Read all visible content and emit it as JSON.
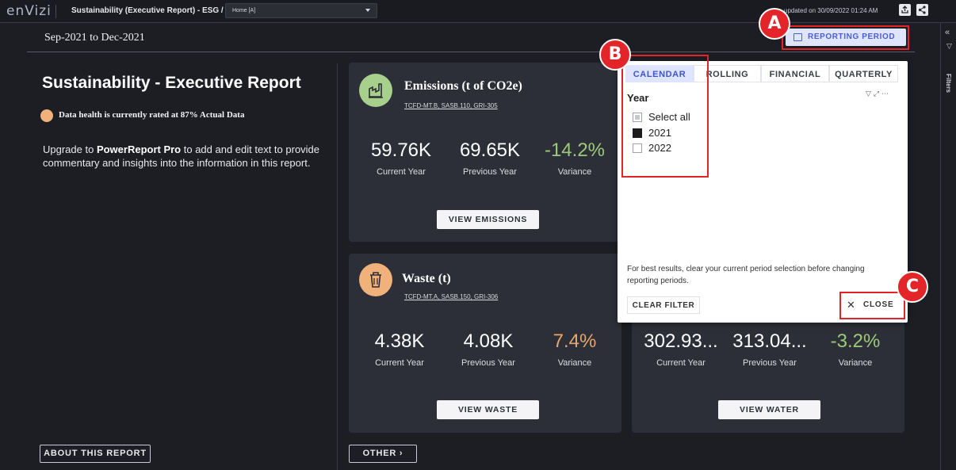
{
  "topbar": {
    "logo": "enVizi",
    "breadcrumb": "Sustainability (Executive Report) - ESG  /",
    "home_select": "Home [A]",
    "updated": "updated on 30/09/2022 01:24 AM",
    "icons": [
      "export-icon",
      "share-icon"
    ]
  },
  "filters_rail": {
    "label": "Filters"
  },
  "period": {
    "range": "Sep-2021 to Dec-2021",
    "button_label": "REPORTING PERIOD"
  },
  "left": {
    "title": "Sustainability - Executive Report",
    "health": "Data health is currently rated at 87% Actual Data",
    "health_color": "#f0b27a",
    "upgrade_pre": "Upgrade to ",
    "upgrade_bold": "PowerReport Pro",
    "upgrade_post": " to add and edit text to provide commentary and insights into the information in this report.",
    "about_button": "ABOUT THIS REPORT",
    "other_button": "OTHER  ›"
  },
  "cards": {
    "emissions": {
      "title": "Emissions (t of CO2e)",
      "sub": "TCFD-MT.B, SASB.110, GRI-305",
      "current": "59.76K",
      "previous": "69.65K",
      "variance": "-14.2%",
      "variance_color": "#9dc97a",
      "icon_color": "#a8d08d",
      "button": "VIEW EMISSIONS"
    },
    "waste": {
      "title": "Waste (t)",
      "sub": "TCFD-MT.A, SASB.150, GRI-306",
      "current": "4.38K",
      "previous": "4.08K",
      "variance": "7.4%",
      "variance_color": "#e8a76a",
      "icon_color": "#f0b27a",
      "button": "VIEW WASTE"
    },
    "water": {
      "current": "302.93...",
      "previous": "313.04...",
      "variance": "-3.2%",
      "variance_color": "#9dc97a",
      "button": "VIEW WATER"
    },
    "labels": {
      "current": "Current Year",
      "previous": "Previous Year",
      "variance": "Variance"
    }
  },
  "popup": {
    "tabs": [
      "CALENDAR",
      "ROLLING",
      "FINANCIAL",
      "QUARTERLY"
    ],
    "active_tab": "CALENDAR",
    "field": "Year",
    "options": [
      {
        "label": "Select all",
        "state": "partial"
      },
      {
        "label": "2021",
        "state": "checked"
      },
      {
        "label": "2022",
        "state": "unchecked"
      }
    ],
    "mini_icons": [
      "filter-icon",
      "expand-icon",
      "more-icon"
    ],
    "hint": "For best results, clear your current period selection before changing reporting periods.",
    "clear_button": "CLEAR FILTER",
    "close_button": "CLOSE"
  },
  "annotations": {
    "a": "A",
    "b": "B",
    "c": "C",
    "color": "#e3252a"
  }
}
